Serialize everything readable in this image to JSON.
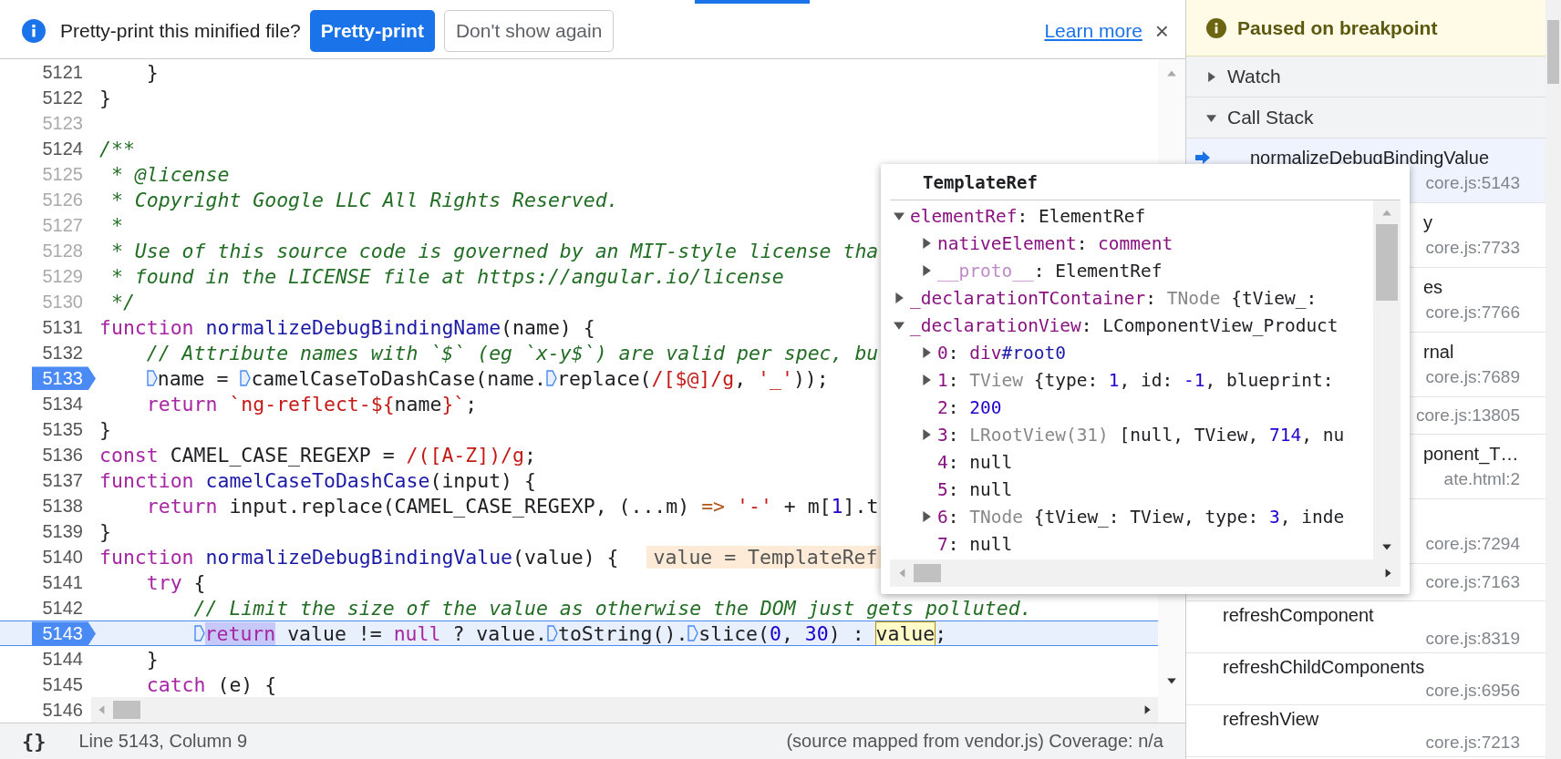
{
  "infobar": {
    "message": "Pretty-print this minified file?",
    "primary_button": "Pretty-print",
    "secondary_button": "Don't show again",
    "link": "Learn more",
    "close": "×"
  },
  "lines": [
    {
      "n": "5121",
      "breakpoint": false,
      "current": false,
      "dim": false,
      "kind": "nested",
      "segs": [
        {
          "kind": "p",
          "text": "}"
        }
      ]
    },
    {
      "n": "5122",
      "breakpoint": false,
      "current": false,
      "dim": false,
      "segs": [
        {
          "kind": "p",
          "text": "}"
        }
      ]
    },
    {
      "n": "5123",
      "breakpoint": false,
      "current": false,
      "dim": true
    },
    {
      "n": "5124",
      "breakpoint": false,
      "current": false,
      "dim": false,
      "segs": [
        {
          "kind": "cm",
          "text": "/**"
        }
      ]
    },
    {
      "n": "5125",
      "breakpoint": false,
      "current": false,
      "dim": true,
      "segs": [
        {
          "kind": "cm",
          "text": " * @license"
        }
      ]
    },
    {
      "n": "5126",
      "breakpoint": false,
      "current": false,
      "dim": true,
      "segs": [
        {
          "kind": "cm",
          "text": " * Copyright Google LLC All Rights Reserved."
        }
      ]
    },
    {
      "n": "5127",
      "breakpoint": false,
      "current": false,
      "dim": true,
      "segs": [
        {
          "kind": "cm",
          "text": " *"
        }
      ]
    },
    {
      "n": "5128",
      "breakpoint": false,
      "current": false,
      "dim": true,
      "segs": [
        {
          "kind": "cm",
          "text": " * Use of this source code is governed by an MIT-style license tha"
        }
      ]
    },
    {
      "n": "5129",
      "breakpoint": false,
      "current": false,
      "dim": true,
      "segs": [
        {
          "kind": "cm",
          "text": " * found in the LICENSE file at https://angular.io/license"
        }
      ]
    },
    {
      "n": "5130",
      "breakpoint": false,
      "current": false,
      "dim": true,
      "segs": [
        {
          "kind": "cm",
          "text": " */"
        }
      ]
    },
    {
      "n": "5131",
      "breakpoint": false,
      "current": false,
      "dim": false,
      "segs": [
        {
          "kind": "kw",
          "text": "function"
        },
        {
          "kind": "fn",
          "text": " normalizeDebugBindingName"
        },
        {
          "kind": "p",
          "text": "(name) {"
        }
      ]
    },
    {
      "n": "5132",
      "breakpoint": false,
      "current": false,
      "dim": false,
      "kind": "nested",
      "segs": [
        {
          "kind": "cm",
          "text": "// Attribute names with `$` (eg `x-y$`) are valid per spec, bu"
        }
      ]
    },
    {
      "n": "5133",
      "breakpoint": true,
      "current": false,
      "dim": false,
      "kind": "nested",
      "segs": [
        {
          "kind": "mk"
        },
        {
          "kind": "p",
          "text": "name = "
        },
        {
          "kind": "mk"
        },
        {
          "kind": "p",
          "text": "camelCaseToDashCase(name."
        },
        {
          "kind": "mk"
        },
        {
          "kind": "p",
          "text": "replace("
        },
        {
          "kind": "re",
          "text": "/[$@]/g"
        },
        {
          "kind": "p",
          "text": ", "
        },
        {
          "kind": "str",
          "text": "'_'"
        },
        {
          "kind": "p",
          "text": "));"
        }
      ]
    },
    {
      "n": "5134",
      "breakpoint": false,
      "current": false,
      "dim": false,
      "kind": "nested",
      "segs": [
        {
          "kind": "kw",
          "text": "return"
        },
        {
          "kind": "str",
          "text": " `ng-reflect-${"
        },
        {
          "kind": "p",
          "text": "name"
        },
        {
          "kind": "str",
          "text": "}`"
        },
        {
          "kind": "p",
          "text": ";"
        }
      ]
    },
    {
      "n": "5135",
      "breakpoint": false,
      "current": false,
      "dim": false,
      "segs": [
        {
          "kind": "p",
          "text": "}"
        }
      ]
    },
    {
      "n": "5136",
      "breakpoint": false,
      "current": false,
      "dim": false,
      "segs": [
        {
          "kind": "kw",
          "text": "const"
        },
        {
          "kind": "p",
          "text": " CAMEL_CASE_REGEXP = "
        },
        {
          "kind": "re",
          "text": "/([A-Z])/g"
        },
        {
          "kind": "p",
          "text": ";"
        }
      ]
    },
    {
      "n": "5137",
      "breakpoint": false,
      "current": false,
      "dim": false,
      "segs": [
        {
          "kind": "kw",
          "text": "function"
        },
        {
          "kind": "fn",
          "text": " camelCaseToDashCase"
        },
        {
          "kind": "p",
          "text": "(input) {"
        }
      ]
    },
    {
      "n": "5138",
      "breakpoint": false,
      "current": false,
      "dim": false,
      "kind": "nested",
      "segs": [
        {
          "kind": "kw",
          "text": "return"
        },
        {
          "kind": "p",
          "text": " input.replace(CAMEL_CASE_REGEXP, (...m) "
        },
        {
          "kind": "op",
          "text": "=>"
        },
        {
          "kind": "str",
          "text": " '-'"
        },
        {
          "kind": "p",
          "text": " + m["
        },
        {
          "kind": "num",
          "text": "1"
        },
        {
          "kind": "p",
          "text": "].t"
        }
      ]
    },
    {
      "n": "5139",
      "breakpoint": false,
      "current": false,
      "dim": false,
      "segs": [
        {
          "kind": "p",
          "text": "}"
        }
      ]
    },
    {
      "n": "5140",
      "breakpoint": false,
      "current": false,
      "dim": false,
      "segs": [
        {
          "kind": "kw",
          "text": "function"
        },
        {
          "kind": "fn",
          "text": " normalizeDebugBindingValue"
        },
        {
          "kind": "p",
          "text": "(value) {"
        },
        {
          "kind": "iv",
          "text": "value = TemplateRef"
        }
      ]
    },
    {
      "n": "5141",
      "breakpoint": false,
      "current": false,
      "dim": false,
      "kind": "nested",
      "segs": [
        {
          "kind": "kw",
          "text": "try"
        },
        {
          "kind": "p",
          "text": " {"
        }
      ]
    },
    {
      "n": "5142",
      "breakpoint": false,
      "current": false,
      "dim": false,
      "kind": "deep",
      "segs": [
        {
          "kind": "cm",
          "text": "// Limit the size of the value as otherwise the DOM just gets polluted."
        }
      ]
    },
    {
      "n": "5143",
      "breakpoint": true,
      "current": true,
      "dim": false,
      "kind": "deep",
      "segs": [
        {
          "kind": "mk"
        },
        {
          "kind": "exec",
          "text": "return"
        },
        {
          "kind": "p",
          "text": " value != "
        },
        {
          "kind": "kw",
          "text": "null"
        },
        {
          "kind": "p",
          "text": " ? value."
        },
        {
          "kind": "mk"
        },
        {
          "kind": "p",
          "text": "toString()."
        },
        {
          "kind": "mk"
        },
        {
          "kind": "p",
          "text": "slice("
        },
        {
          "kind": "num",
          "text": "0"
        },
        {
          "kind": "p",
          "text": ", "
        },
        {
          "kind": "num",
          "text": "30"
        },
        {
          "kind": "p",
          "text": ") : "
        },
        {
          "kind": "hover",
          "text": "value"
        },
        {
          "kind": "p",
          "text": ";"
        }
      ]
    },
    {
      "n": "5144",
      "breakpoint": false,
      "current": false,
      "dim": false,
      "kind": "nested",
      "segs": [
        {
          "kind": "p",
          "text": "}"
        }
      ]
    },
    {
      "n": "5145",
      "breakpoint": false,
      "current": false,
      "dim": false,
      "kind": "nested",
      "segs": [
        {
          "kind": "kw",
          "text": "catch"
        },
        {
          "kind": "p",
          "text": " (e) {"
        }
      ]
    },
    {
      "n": "5146",
      "breakpoint": false,
      "current": false,
      "dim": false
    }
  ],
  "status_bar": {
    "format_button": "{}",
    "position": "Line 5143, Column 9",
    "source": "(source mapped from vendor.js) Coverage: n/a"
  },
  "popover": {
    "title": "TemplateRef",
    "tree": [
      {
        "key": "elementRef",
        "inherited": false,
        "kind": "object",
        "expanded": true,
        "value": [
          {
            "kind": "p",
            "text": ": ElementRef"
          }
        ],
        "children": [
          {
            "key": "nativeElement",
            "inherited": false,
            "kind": "object",
            "expanded": false,
            "value": [
              {
                "kind": "p",
                "text": ": "
              },
              {
                "kind": "elem",
                "text": "comment"
              }
            ]
          },
          {
            "key": "__proto__",
            "inherited": true,
            "kind": "object",
            "expanded": false,
            "value": [
              {
                "kind": "p",
                "text": ": ElementRef"
              }
            ]
          }
        ]
      },
      {
        "key": "_declarationTContainer",
        "inherited": false,
        "kind": "object",
        "expanded": false,
        "value": [
          {
            "kind": "p",
            "text": ": "
          },
          {
            "kind": "type",
            "text": "TNode"
          },
          {
            "kind": "p",
            "text": " {tView_:"
          }
        ]
      },
      {
        "key": "_declarationView",
        "inherited": false,
        "kind": "object",
        "expanded": true,
        "value": [
          {
            "kind": "p",
            "text": ": LComponentView_Product"
          }
        ],
        "children": [
          {
            "key": "0",
            "inherited": false,
            "kind": "object",
            "expanded": false,
            "value": [
              {
                "kind": "p",
                "text": ": "
              },
              {
                "kind": "elem",
                "text": "div"
              },
              {
                "kind": "id",
                "text": "#root0"
              }
            ]
          },
          {
            "key": "1",
            "inherited": false,
            "kind": "object",
            "expanded": false,
            "value": [
              {
                "kind": "p",
                "text": ": "
              },
              {
                "kind": "type",
                "text": "TView"
              },
              {
                "kind": "p",
                "text": " {type: "
              },
              {
                "kind": "num",
                "text": "1"
              },
              {
                "kind": "p",
                "text": ", id: "
              },
              {
                "kind": "num",
                "text": "-1"
              },
              {
                "kind": "p",
                "text": ", blueprint:"
              }
            ]
          },
          {
            "key": "2",
            "inherited": false,
            "kind": "value",
            "value": [
              {
                "kind": "p",
                "text": ": "
              },
              {
                "kind": "num",
                "text": "200"
              }
            ]
          },
          {
            "key": "3",
            "inherited": false,
            "kind": "object",
            "expanded": false,
            "value": [
              {
                "kind": "p",
                "text": ": "
              },
              {
                "kind": "type",
                "text": "LRootView(31)"
              },
              {
                "kind": "p",
                "text": " [null, TView, "
              },
              {
                "kind": "num",
                "text": "714"
              },
              {
                "kind": "p",
                "text": ", nu"
              }
            ]
          },
          {
            "key": "4",
            "inherited": false,
            "kind": "value",
            "value": [
              {
                "kind": "p",
                "text": ": null"
              }
            ]
          },
          {
            "key": "5",
            "inherited": false,
            "kind": "value",
            "value": [
              {
                "kind": "p",
                "text": ": null"
              }
            ]
          },
          {
            "key": "6",
            "inherited": false,
            "kind": "object",
            "expanded": false,
            "value": [
              {
                "kind": "p",
                "text": ": "
              },
              {
                "kind": "type",
                "text": "TNode"
              },
              {
                "kind": "p",
                "text": " {tView_: TView, type: "
              },
              {
                "kind": "num",
                "text": "3"
              },
              {
                "kind": "p",
                "text": ", inde"
              }
            ]
          },
          {
            "key": "7",
            "inherited": false,
            "kind": "value",
            "value": [
              {
                "kind": "p",
                "text": ": null"
              }
            ]
          }
        ]
      }
    ]
  },
  "sidebar": {
    "paused": "Paused on breakpoint",
    "sections": [
      {
        "label": "Watch",
        "expanded": false
      },
      {
        "label": "Call Stack",
        "expanded": true
      }
    ],
    "call_stack": [
      {
        "name": "normalizeDebugBindingValue",
        "location": "core.js:5143",
        "kind": "full",
        "selected": true
      },
      {
        "name": "y",
        "location": "core.js:7733",
        "kind": "partial",
        "selected": false
      },
      {
        "name": "es",
        "location": "core.js:7766",
        "kind": "partial",
        "selected": false
      },
      {
        "name": "rnal",
        "location": "core.js:7689",
        "kind": "partial",
        "selected": false
      },
      {
        "location": "core.js:13805",
        "kind": "single",
        "selected": false
      },
      {
        "name": "ponent_T…",
        "location": "ate.html:2",
        "kind": "partial",
        "selected": false
      },
      {
        "location": "core.js:7294",
        "kind": "covered",
        "selected": false
      },
      {
        "location": "core.js:7163",
        "kind": "single",
        "selected": false
      },
      {
        "name": "refreshComponent",
        "location": "core.js:8319",
        "kind": "full",
        "selected": false
      },
      {
        "name": "refreshChildComponents",
        "location": "core.js:6956",
        "kind": "full",
        "selected": false
      },
      {
        "name": "refreshView",
        "location": "core.js:7213",
        "kind": "full",
        "selected": false
      }
    ]
  }
}
